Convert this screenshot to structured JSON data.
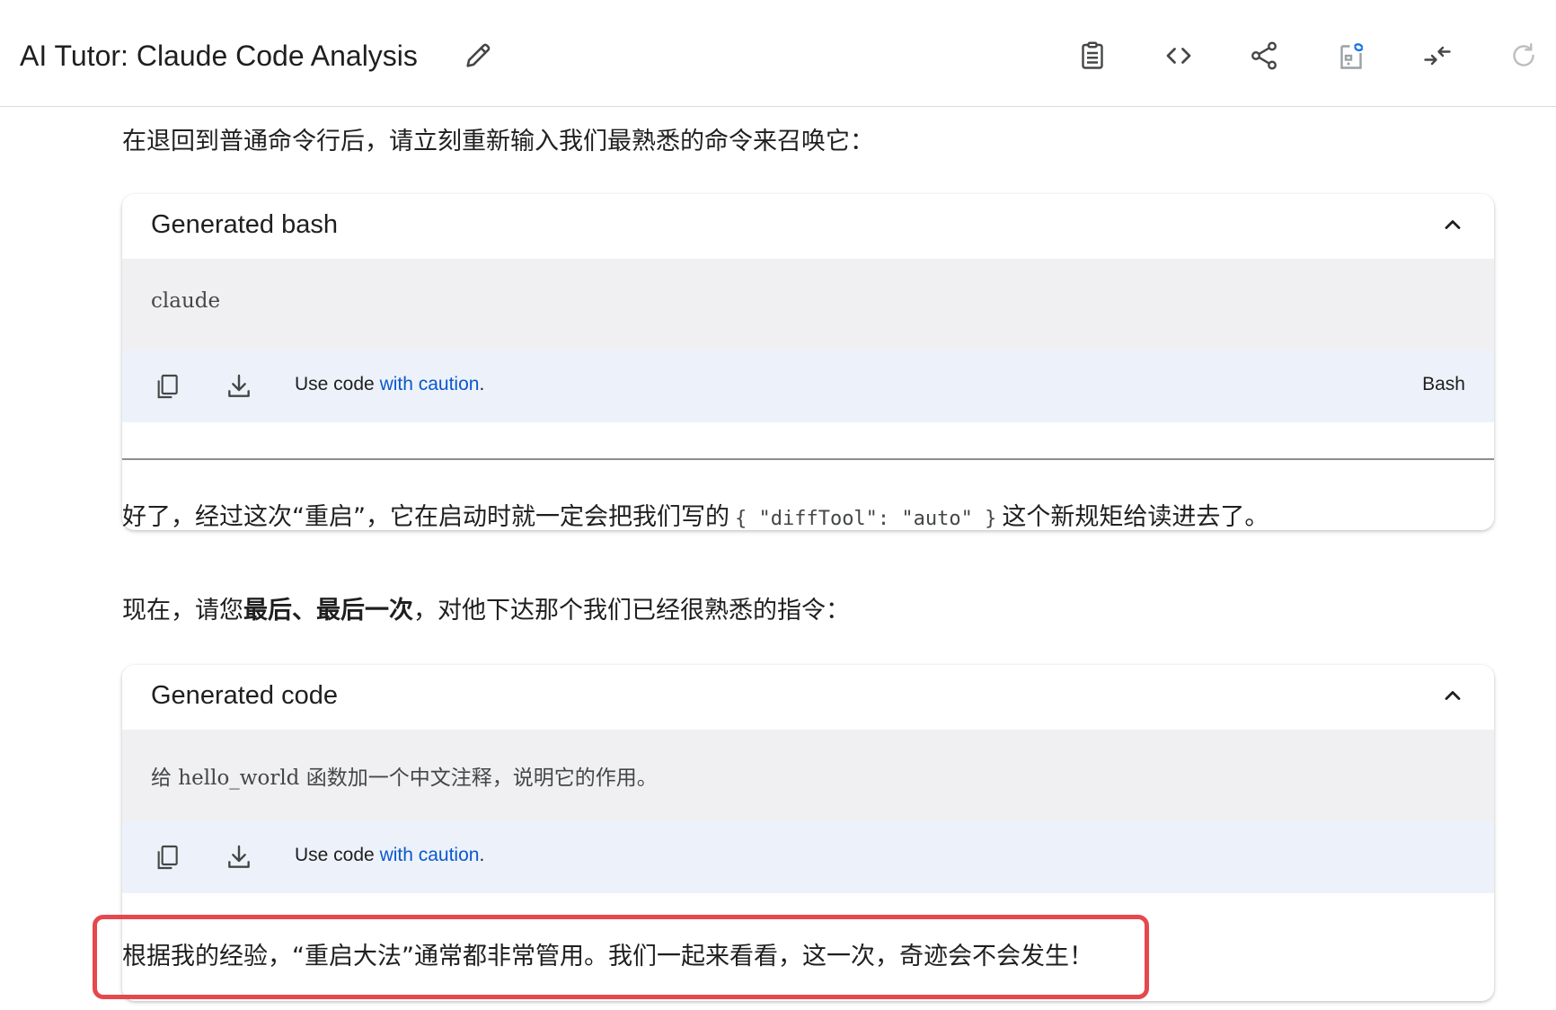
{
  "header": {
    "title": "AI Tutor: Claude Code Analysis",
    "icons": [
      "pencil-icon",
      "clipboard-icon",
      "code-icon",
      "share-icon",
      "sync-doc-icon",
      "compress-icon",
      "refresh-icon"
    ]
  },
  "content": {
    "para1": "在退回到普通命令行后，请立刻重新输入我们最熟悉的命令来召唤它：",
    "block1": {
      "title": "Generated bash",
      "code": "claude",
      "caution_prefix": "Use code ",
      "caution_link": "with caution",
      "caution_suffix": ".",
      "language": "Bash"
    },
    "para2": {
      "before": "好了，经过这次“重启”，它在启动时就一定会把我们写的",
      "code": "{ \"diffTool\": \"auto\" }",
      "after": "这个新规矩给读进去了。"
    },
    "para3": {
      "before": "现在，请您",
      "bold": "最后、最后一次",
      "after": "，对他下达那个我们已经很熟悉的指令："
    },
    "block2": {
      "title": "Generated code",
      "code": "给 hello_world 函数加一个中文注释，说明它的作用。",
      "caution_prefix": "Use code ",
      "caution_link": "with caution",
      "caution_suffix": "."
    },
    "para4": "根据我的经验，“重启大法”通常都非常管用。我们一起来看看，这一次，奇迹会不会发生！"
  },
  "colors": {
    "link": "#0b57d0",
    "highlight": "#e5484d",
    "code_bg": "#f0f0f3",
    "foot_bg": "#edf2fa"
  }
}
